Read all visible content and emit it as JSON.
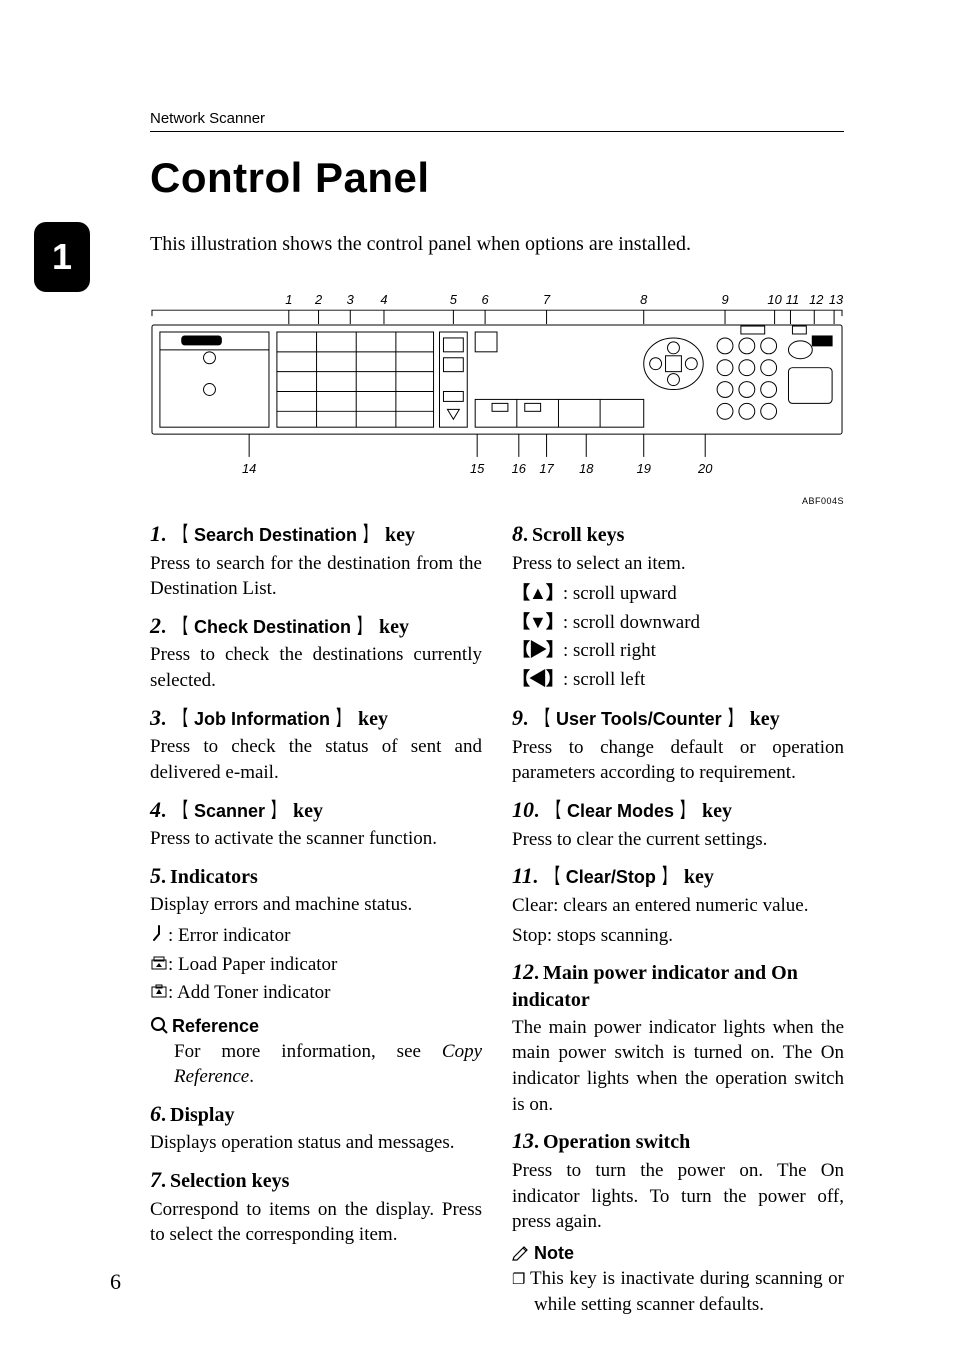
{
  "chapter_number": "1",
  "running_head": "Network Scanner",
  "title": "Control Panel",
  "intro": "This illustration shows the control panel when options are installed.",
  "figure": {
    "callout_top": [
      "1",
      "2",
      "3",
      "4",
      "5",
      "6",
      "7",
      "8",
      "9",
      "10",
      "11",
      "12",
      "13"
    ],
    "callout_bottom": [
      "14",
      "15",
      "16",
      "17",
      "18",
      "19",
      "20"
    ],
    "image_id": "ABF004S"
  },
  "left": [
    {
      "n": "1",
      "key": "Search Destination",
      "suffix": "key",
      "body": "Press to search for the destination from the Destination List."
    },
    {
      "n": "2",
      "key": "Check Destination",
      "suffix": "key",
      "body": "Press to check the destinations currently selected."
    },
    {
      "n": "3",
      "key": "Job Information",
      "suffix": "key",
      "body": "Press to check the status of sent and delivered e-mail."
    },
    {
      "n": "4",
      "key": "Scanner",
      "suffix": "key",
      "body": "Press to activate the scanner function."
    },
    {
      "n": "5",
      "plain_title": "Indicators",
      "body": "Display errors and machine status.",
      "lines": [
        {
          "icon": "error",
          "text": ": Error indicator"
        },
        {
          "icon": "paper",
          "text": ": Load Paper indicator"
        },
        {
          "icon": "toner",
          "text": ": Add Toner indicator"
        }
      ],
      "reference": {
        "label": "Reference",
        "text_a": "For more information, see ",
        "text_ital": "Copy Reference",
        "text_b": "."
      }
    },
    {
      "n": "6",
      "plain_title": "Display",
      "body": "Displays operation status and messages."
    },
    {
      "n": "7",
      "plain_title": "Selection keys",
      "body": "Correspond to items on the display. Press to select the corresponding item."
    }
  ],
  "right": [
    {
      "n": "8",
      "plain_title": "Scroll keys",
      "body": "Press to select an item.",
      "arrows": [
        {
          "sym": "▲",
          "text": ": scroll upward"
        },
        {
          "sym": "▼",
          "text": ": scroll downward"
        },
        {
          "sym": "▶",
          "text": ": scroll right"
        },
        {
          "sym": "◀",
          "text": ": scroll left"
        }
      ]
    },
    {
      "n": "9",
      "key": "User Tools/Counter",
      "suffix": "key",
      "body": "Press to change default or operation parameters according to requirement."
    },
    {
      "n": "10",
      "key": "Clear Modes",
      "suffix": "key",
      "body": "Press to clear the current settings."
    },
    {
      "n": "11",
      "key": "Clear/Stop",
      "suffix": "key",
      "body_lines": [
        "Clear: clears an entered numeric value.",
        "Stop: stops scanning."
      ]
    },
    {
      "n": "12",
      "plain_title": "Main power indicator and On indicator",
      "body": "The main power indicator lights when the main power switch is turned on. The On indicator lights when the operation switch is on."
    },
    {
      "n": "13",
      "plain_title": "Operation switch",
      "body": "Press to turn the power on. The On indicator lights. To turn the power off, press again.",
      "note": {
        "label": "Note",
        "items": [
          "This key is inactivate during scanning or while setting scanner defaults."
        ]
      }
    }
  ],
  "page_number": "6"
}
